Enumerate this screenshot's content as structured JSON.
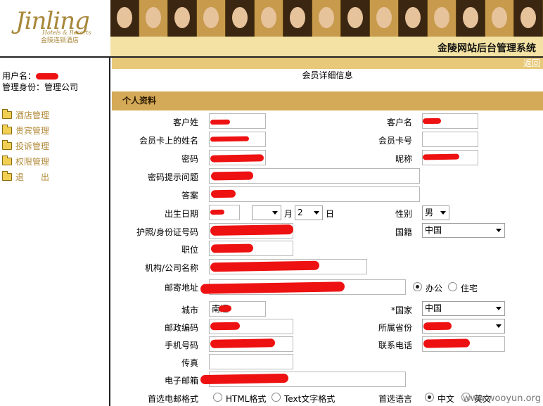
{
  "logo": {
    "brand": "Jinling",
    "sub_en": "Hotels & Resorts",
    "sub_cn": "金陵连锁酒店"
  },
  "header": {
    "title": "金陵网站后台管理系统"
  },
  "sidebar": {
    "username_label": "用户名：",
    "role_label": "管理身份：管理公司",
    "menu": [
      {
        "label": "酒店管理",
        "icon": "folder-icon"
      },
      {
        "label": "贵宾管理",
        "icon": "folder-icon"
      },
      {
        "label": "投诉管理",
        "icon": "folder-icon"
      },
      {
        "label": "权限管理",
        "icon": "folder-icon"
      },
      {
        "label": "退　　出",
        "icon": "folder-icon"
      }
    ]
  },
  "main": {
    "back_link": "返回",
    "page_title": "会员详细信息",
    "section_title": "个人资料",
    "labels": {
      "surname": "客户姓",
      "given_name": "客户名",
      "card_name": "会员卡上的姓名",
      "card_no": "会员卡号",
      "password": "密码",
      "nickname": "昵称",
      "pwd_question": "密码提示问题",
      "answer": "答案",
      "birthday": "出生日期",
      "month": "月",
      "day": "日",
      "gender": "性别",
      "id_no": "护照/身份证号码",
      "nationality": "国籍",
      "position": "职位",
      "company": "机构/公司名称",
      "address": "邮寄地址",
      "addr_office": "办公",
      "addr_home": "住宅",
      "city": "城市",
      "country": "*国家",
      "postcode": "邮政编码",
      "province": "所属省份",
      "mobile": "手机号码",
      "phone": "联系电话",
      "fax": "传真",
      "email": "电子邮箱",
      "email_format": "首选电邮格式",
      "fmt_html": "HTML格式",
      "fmt_text": "Text文字格式",
      "language": "首选语言",
      "lang_cn": "中文",
      "lang_en": "英文"
    },
    "values": {
      "day": "2",
      "gender": "男",
      "nationality": "中国",
      "country": "中国",
      "city": "南通",
      "address_type": "办公",
      "language": "中文"
    }
  },
  "watermark": "www.wooyun.org",
  "colors": {
    "menu_text": "#b38b3a",
    "section_bar": "#d4aa59",
    "back_bar": "#e8c97a",
    "title_bar": "#f3e2a3",
    "redaction": "#ee1111"
  }
}
